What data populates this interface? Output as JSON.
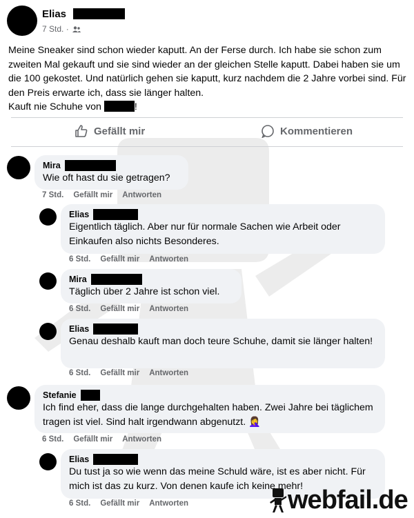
{
  "post": {
    "author": "Elias",
    "time": "7 Std. ·",
    "text_lines": [
      "Meine Sneaker sind schon wieder kaputt. An der Ferse durch. Ich habe sie schon zum zweiten Mal gekauft und sie sind wieder an der gleichen Stelle kaputt. Dabei haben sie um die 100 gekostet. Und natürlich gehen sie kaputt, kurz nachdem die 2 Jahre vorbei sind. Für den Preis erwarte ich, dass sie länger halten."
    ],
    "last_line_prefix": "Kauft nie Schuhe von",
    "last_line_suffix": "!"
  },
  "actions": {
    "like": "Gefällt mir",
    "comment": "Kommentieren"
  },
  "comments": [
    {
      "author": "Mira",
      "text": "Wie oft hast du sie getragen?",
      "time": "7 Std.",
      "like": "Gefällt mir",
      "reply": "Antworten"
    },
    {
      "author": "Elias",
      "text": "Eigentlich täglich. Aber nur für normale Sachen wie Arbeit oder Einkaufen also nichts Besonderes.",
      "time": "6 Std.",
      "like": "Gefällt mir",
      "reply": "Antworten"
    },
    {
      "author": "Mira",
      "text": "Täglich über 2 Jahre ist schon viel.",
      "time": "6 Std.",
      "like": "Gefällt mir",
      "reply": "Antworten"
    },
    {
      "author": "Elias",
      "text": "Genau deshalb kauft man doch teure Schuhe, damit sie länger halten!",
      "time": "6 Std.",
      "like": "Gefällt mir",
      "reply": "Antworten"
    },
    {
      "author": "Stefanie",
      "text": "Ich find eher, dass die lange durchgehalten haben. Zwei Jahre bei täglichem tragen ist viel. Sind halt irgendwann abgenutzt. 🤦‍♀️",
      "time": "6 Std.",
      "like": "Gefällt mir",
      "reply": "Antworten"
    },
    {
      "author": "Elias",
      "text": "Du tust ja so wie wenn das meine Schuld wäre, ist es aber nicht. Für mich ist das zu kurz. Von denen kaufe ich keine mehr!",
      "time": "6 Std.",
      "like": "Gefällt mir",
      "reply": "Antworten"
    }
  ],
  "brand": "webfail.de",
  "colors": {
    "bubble": "#f0f2f5",
    "meta": "#65676b",
    "divider": "#ced0d4"
  }
}
